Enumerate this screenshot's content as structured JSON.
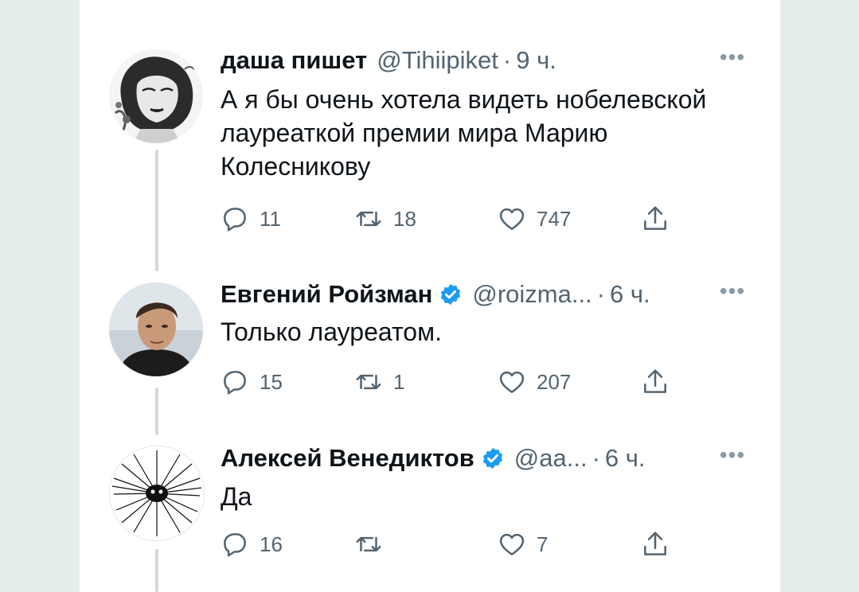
{
  "tweets": [
    {
      "name": "даша пишет",
      "handle": "@Tihiipiket",
      "time": "9 ч.",
      "verified": false,
      "text": "А я бы очень хотела видеть нобелевской лауреаткой премии мира Марию Колесникову",
      "replies": "11",
      "retweets": "18",
      "likes": "747",
      "avatar_icon": "illustrated-woman-avatar"
    },
    {
      "name": "Евгений Ройзман",
      "handle": "@roizma...",
      "time": "6 ч.",
      "verified": true,
      "text": "Только лауреатом.",
      "replies": "15",
      "retweets": "1",
      "likes": "207",
      "avatar_icon": "man-photo-avatar"
    },
    {
      "name": "Алексей Венедиктов",
      "handle": "@aa...",
      "time": "6 ч.",
      "verified": true,
      "text": "Да",
      "replies": "16",
      "retweets": "",
      "likes": "7",
      "avatar_icon": "hairy-creature-avatar"
    }
  ],
  "more_label": "•••",
  "colors": {
    "verified": "#1d9bf0",
    "secondary": "#536471",
    "line": "#cfd9de"
  }
}
